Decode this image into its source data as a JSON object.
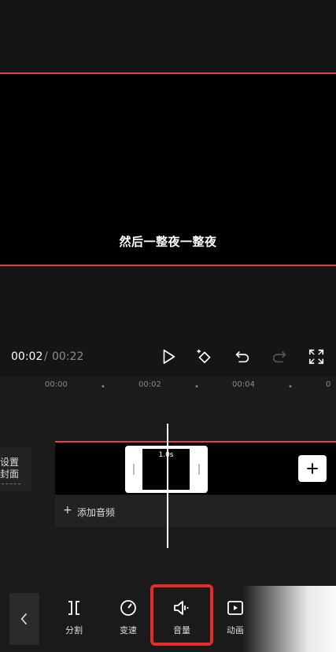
{
  "preview": {
    "subtitle": "然后一整夜一整夜"
  },
  "playback": {
    "current_time": "00:02",
    "separator": "/",
    "total_time": "00:22"
  },
  "timeline": {
    "ruler": [
      "00:00",
      "00:02",
      "00:04"
    ],
    "cover_label_line1": "设置",
    "cover_label_line2": "封面",
    "clip_duration": "1.0s",
    "add_audio_label": "添加音频"
  },
  "toolbar": {
    "items": [
      {
        "label": "分割",
        "icon": "split-icon"
      },
      {
        "label": "变速",
        "icon": "speed-icon"
      },
      {
        "label": "音量",
        "icon": "volume-icon"
      },
      {
        "label": "动画",
        "icon": "animation-icon"
      }
    ]
  },
  "colors": {
    "accent_red": "#e0404a",
    "highlight_red": "#e52b2b",
    "background": "#161616"
  }
}
